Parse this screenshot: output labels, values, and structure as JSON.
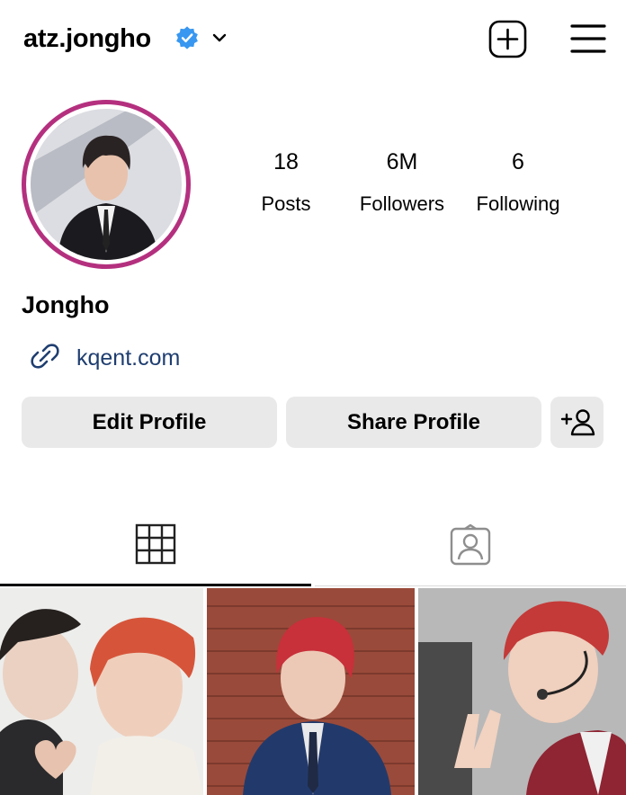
{
  "header": {
    "username": "atz.jongho",
    "icons": {
      "verified": "verified-badge-icon",
      "switch": "chevron-down-icon",
      "create": "plus-square-icon",
      "menu": "hamburger-menu-icon"
    }
  },
  "profile": {
    "display_name": "Jongho",
    "website": "kqent.com",
    "avatar": "profile-photo",
    "ring_color": "#b4307f"
  },
  "stats": [
    {
      "value": "18",
      "label": "Posts"
    },
    {
      "value": "6M",
      "label": "Followers"
    },
    {
      "value": "6",
      "label": "Following"
    }
  ],
  "actions": {
    "edit_label": "Edit Profile",
    "share_label": "Share Profile",
    "discover_icon": "add-person-icon"
  },
  "tabs": [
    {
      "name": "posts-grid",
      "icon": "grid-icon",
      "active": true
    },
    {
      "name": "tagged",
      "icon": "tagged-user-icon",
      "active": false
    }
  ],
  "posts": [
    {
      "thumb": "post-thumbnail-1"
    },
    {
      "thumb": "post-thumbnail-2"
    },
    {
      "thumb": "post-thumbnail-3"
    }
  ],
  "colors": {
    "link": "#1f3e70",
    "button_bg": "#e9e9e9",
    "verified": "#3897f0"
  }
}
